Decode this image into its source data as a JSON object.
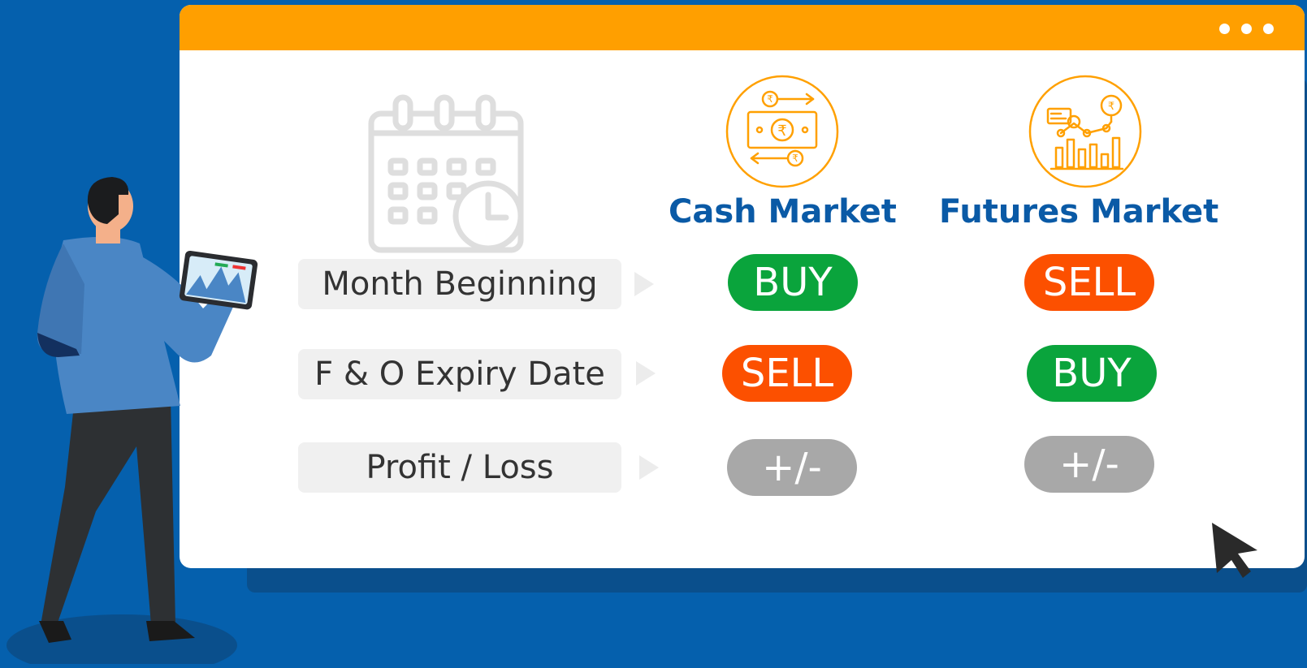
{
  "theme": {
    "background": "#0560ad",
    "accent": "#ff9f00",
    "heading_color": "#0a5aa6",
    "buy_color": "#0aa43c",
    "sell_color": "#fc5000",
    "neutral_color": "#a8a8a8"
  },
  "window": {
    "menu_icon": "three-dots-icon"
  },
  "columns": [
    {
      "title": "Cash Market",
      "icon": "rupee-exchange-icon"
    },
    {
      "title": "Futures Market",
      "icon": "market-chart-icon"
    }
  ],
  "header_icon": "calendar-clock-icon",
  "rows": [
    {
      "label": "Month Beginning",
      "cash": "BUY",
      "futures": "SELL"
    },
    {
      "label": "F & O Expiry Date",
      "cash": "SELL",
      "futures": "BUY"
    },
    {
      "label": "Profit / Loss",
      "cash": "+/-",
      "futures": "+/-"
    }
  ]
}
